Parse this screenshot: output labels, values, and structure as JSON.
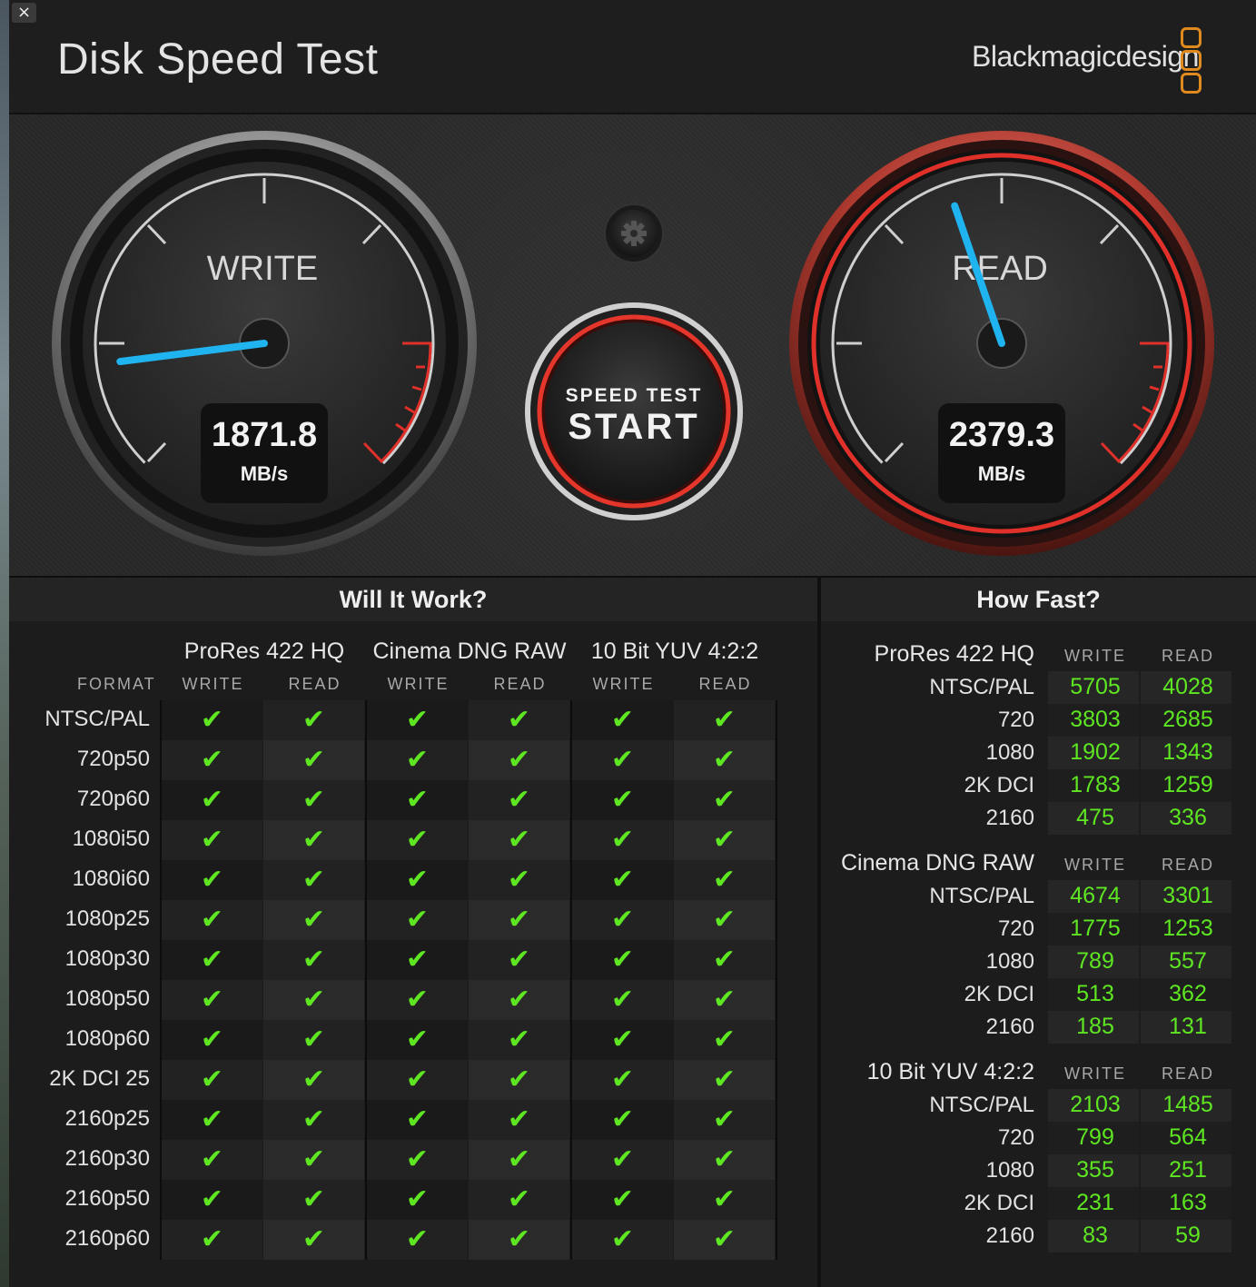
{
  "window": {
    "close_glyph": "×",
    "title": "Disk Speed Test",
    "brand": "Blackmagicdesign"
  },
  "gauges": {
    "write": {
      "label": "WRITE",
      "value": "1871.8",
      "unit": "MB/s",
      "needle_fraction": 0.14
    },
    "read": {
      "label": "READ",
      "value": "2379.3",
      "unit": "MB/s",
      "needle_fraction": 0.43
    },
    "settings_icon": "gear-icon",
    "start_button": {
      "line1": "SPEED TEST",
      "line2": "START"
    }
  },
  "will_it_work": {
    "title": "Will It Work?",
    "format_header": "FORMAT",
    "groups": [
      {
        "name": "ProRes 422 HQ",
        "write": "WRITE",
        "read": "READ"
      },
      {
        "name": "Cinema DNG RAW",
        "write": "WRITE",
        "read": "READ"
      },
      {
        "name": "10 Bit YUV 4:2:2",
        "write": "WRITE",
        "read": "READ"
      }
    ],
    "check_glyph": "✔",
    "rows": [
      "NTSC/PAL",
      "720p50",
      "720p60",
      "1080i50",
      "1080i60",
      "1080p25",
      "1080p30",
      "1080p50",
      "1080p60",
      "2K DCI 25",
      "2160p25",
      "2160p30",
      "2160p50",
      "2160p60"
    ]
  },
  "how_fast": {
    "title": "How Fast?",
    "sections": [
      {
        "name": "ProRes 422 HQ",
        "write": "WRITE",
        "read": "READ",
        "rows": [
          {
            "label": "NTSC/PAL",
            "write": "5705",
            "read": "4028"
          },
          {
            "label": "720",
            "write": "3803",
            "read": "2685"
          },
          {
            "label": "1080",
            "write": "1902",
            "read": "1343"
          },
          {
            "label": "2K DCI",
            "write": "1783",
            "read": "1259"
          },
          {
            "label": "2160",
            "write": "475",
            "read": "336"
          }
        ]
      },
      {
        "name": "Cinema DNG RAW",
        "write": "WRITE",
        "read": "READ",
        "rows": [
          {
            "label": "NTSC/PAL",
            "write": "4674",
            "read": "3301"
          },
          {
            "label": "720",
            "write": "1775",
            "read": "1253"
          },
          {
            "label": "1080",
            "write": "789",
            "read": "557"
          },
          {
            "label": "2K DCI",
            "write": "513",
            "read": "362"
          },
          {
            "label": "2160",
            "write": "185",
            "read": "131"
          }
        ]
      },
      {
        "name": "10 Bit YUV 4:2:2",
        "write": "WRITE",
        "read": "READ",
        "rows": [
          {
            "label": "NTSC/PAL",
            "write": "2103",
            "read": "1485"
          },
          {
            "label": "720",
            "write": "799",
            "read": "564"
          },
          {
            "label": "1080",
            "write": "355",
            "read": "251"
          },
          {
            "label": "2K DCI",
            "write": "231",
            "read": "163"
          },
          {
            "label": "2160",
            "write": "83",
            "read": "59"
          }
        ]
      }
    ]
  },
  "colors": {
    "accent_green": "#5ee622",
    "needle_blue": "#1fb4ef",
    "danger_red": "#e0302a",
    "logo_orange": "#e08a1e"
  }
}
